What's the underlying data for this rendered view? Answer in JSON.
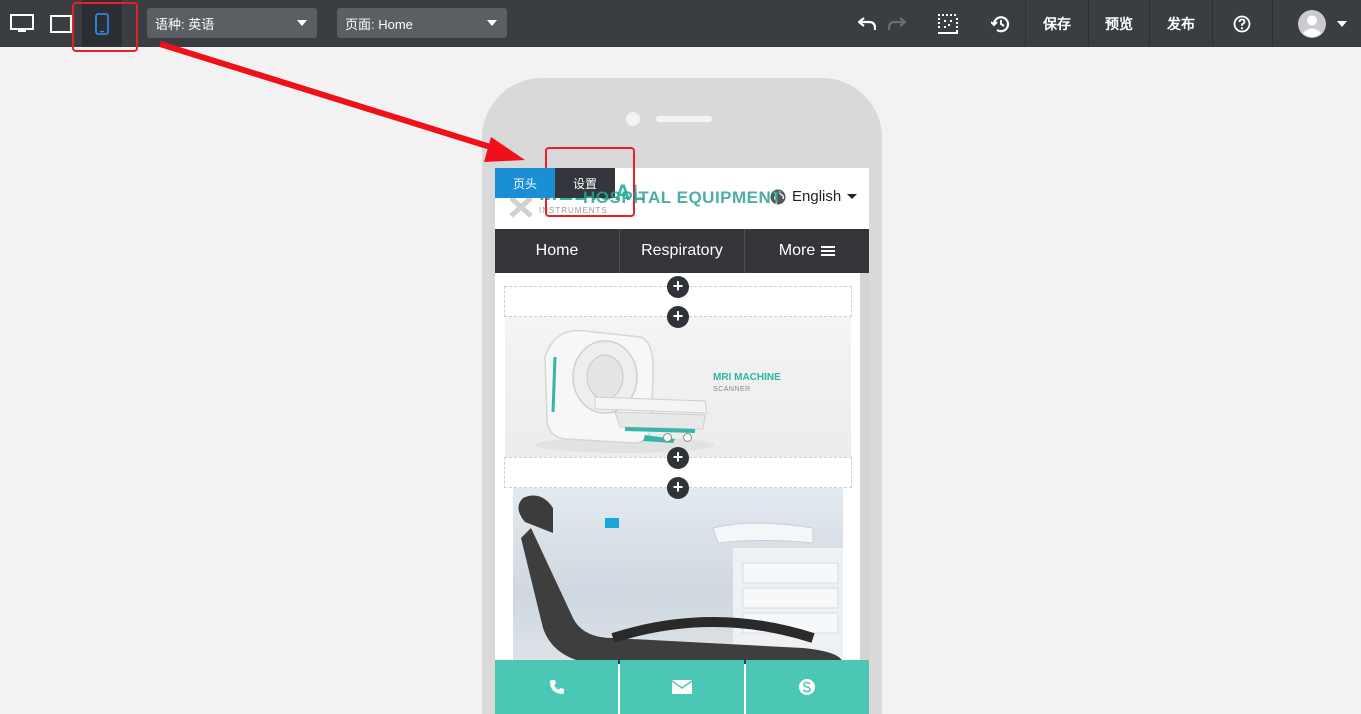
{
  "toolbar": {
    "language_select": "语种: 英语",
    "page_select": "页面: Home",
    "save": "保存",
    "preview": "预览",
    "publish": "发布"
  },
  "colors": {
    "toolbar_bg": "#3a3d42",
    "accent_blue": "#1a8fd3",
    "teal": "#4cc7b6",
    "annotation_red": "#e8202a"
  },
  "icons": [
    "desktop-icon",
    "tablet-icon",
    "mobile-icon",
    "undo-icon",
    "redo-icon",
    "grid-icon",
    "history-icon",
    "help-icon",
    "user-avatar-icon",
    "globe-icon",
    "phone-icon",
    "mail-icon",
    "skype-icon",
    "plus-icon"
  ],
  "preview": {
    "header_tab": "页头",
    "settings_tab": "设置",
    "logo_main": "MEDICAL",
    "logo_sub": "INSTRUMENTS",
    "language": "English",
    "nav": [
      "Home",
      "Respiratory",
      "More"
    ],
    "banner_title": "MRI MACHINE",
    "banner_subtitle": "SCANNER",
    "footer_text": "HOSPITAL EQUIPMENT"
  }
}
